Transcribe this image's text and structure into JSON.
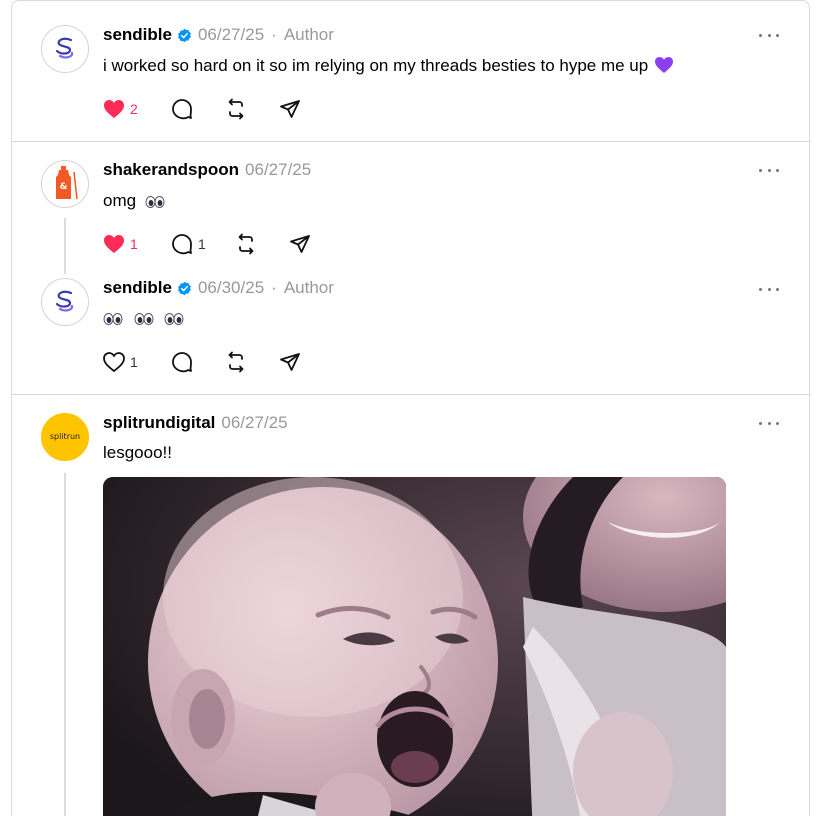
{
  "colors": {
    "like_red": "#ff2a55",
    "meta_gray": "#999999",
    "verified_blue": "#0095f6",
    "purple_heart": "#8a3ff0"
  },
  "posts": [
    {
      "username": "sendible",
      "verified": true,
      "date": "06/27/25",
      "separator": "·",
      "author_tag": "Author",
      "text": "i worked so hard on it so im relying on my threads besties to hype me up",
      "emoji": "purple-heart",
      "liked": true,
      "likes": "2",
      "replies": "",
      "avatar_icon": "sendible-logo-icon"
    },
    {
      "username": "shakerandspoon",
      "verified": false,
      "date": "06/27/25",
      "text": "omg",
      "emoji": "eyes",
      "liked": true,
      "likes": "1",
      "replies": "1",
      "avatar_icon": "shaker-logo-icon"
    },
    {
      "username": "sendible",
      "verified": true,
      "date": "06/30/25",
      "separator": "·",
      "author_tag": "Author",
      "text": "",
      "emoji": "eyes x3",
      "liked": false,
      "likes": "1",
      "replies": "",
      "avatar_icon": "sendible-logo-icon"
    },
    {
      "username": "splitrundigital",
      "verified": false,
      "date": "06/27/25",
      "text": "lesgooo!!",
      "avatar_text": "splitrun",
      "avatar_icon": "splitrun-logo-icon",
      "media": "baby-excited-gif"
    }
  ]
}
